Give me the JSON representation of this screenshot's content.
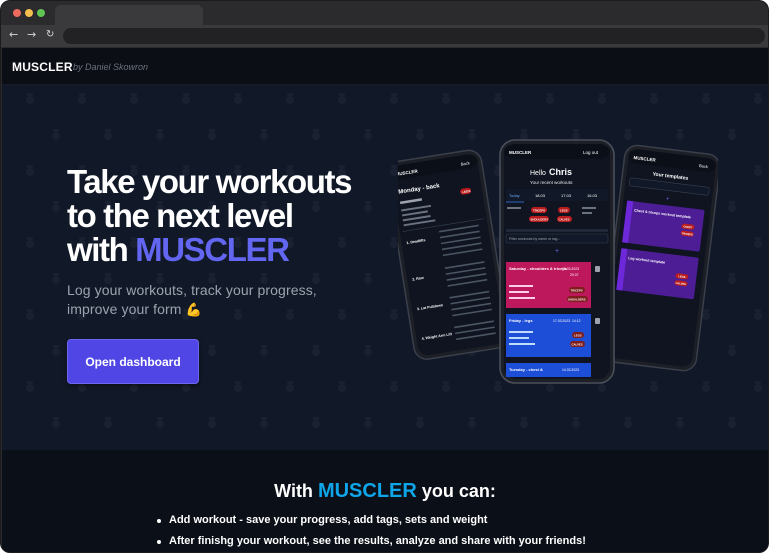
{
  "browser": {
    "nav": {
      "back": "←",
      "forward": "→",
      "reload": "↻"
    }
  },
  "header": {
    "brand": "MUSCLER",
    "byline": "by Daniel Skowron"
  },
  "hero": {
    "title_line1": "Take your workouts",
    "title_line2": "to the next level",
    "title_line3_prefix": "with ",
    "title_line3_accent": "MUSCLER",
    "subtitle": "Log your workouts, track your progress, improve your form",
    "subtitle_emoji": "💪",
    "cta_label": "Open dashboard"
  },
  "phones": {
    "left": {
      "app": "MUSCLER",
      "back": "Back",
      "title": "Monday - back",
      "tag": "LEGS",
      "exercises": [
        "1. Deadlifts",
        "2. Row",
        "3. Lat Pulldown",
        "4. Weight Arm Lift"
      ]
    },
    "center": {
      "app": "MUSCLER",
      "logout": "Log out",
      "greeting_prefix": "Hello",
      "greeting_name": "Chris",
      "recent_label": "Your recent workouts:",
      "dates": [
        "Today",
        "18.03",
        "17.03",
        "16.03"
      ],
      "tags": [
        "TRICEPS",
        "LEGS",
        "SHOULDERS",
        "CALVES"
      ],
      "filter_placeholder": "Filter workouts by name or tag...",
      "cards": [
        {
          "name": "Saturday - shoulders & triceps",
          "date": "19.03.2023",
          "time": "20:37",
          "tags": [
            "TRICEPS",
            "SHOULDERS"
          ]
        },
        {
          "name": "Friday - legs",
          "date": "17.03.2023",
          "time": "14:12",
          "tags": [
            "LEGS",
            "CALVES"
          ]
        },
        {
          "name": "Tuesday - chest &",
          "date": "14.03.2023",
          "time": "",
          "tags": []
        }
      ]
    },
    "right": {
      "app": "MUSCLER",
      "back": "Back",
      "title": "Your templates",
      "cards": [
        {
          "name": "Chest & triceps workout template",
          "tags": [
            "CHEST",
            "TRICEPS"
          ]
        },
        {
          "name": "Leg workout template",
          "tags": [
            "LEGS",
            "CALVES"
          ]
        }
      ]
    }
  },
  "features": {
    "title_prefix": "With",
    "title_accent": "MUSCLER",
    "title_suffix": "you can:",
    "items": [
      "Add workout - save your progress, add tags, sets and weight",
      "After finishg your workout, see the results, analyze and share with your friends!"
    ]
  },
  "colors": {
    "accent": "#6366f1",
    "accent_features": "#0ea5e9",
    "hero_bg": "#111827",
    "button": "#4f46e5"
  }
}
